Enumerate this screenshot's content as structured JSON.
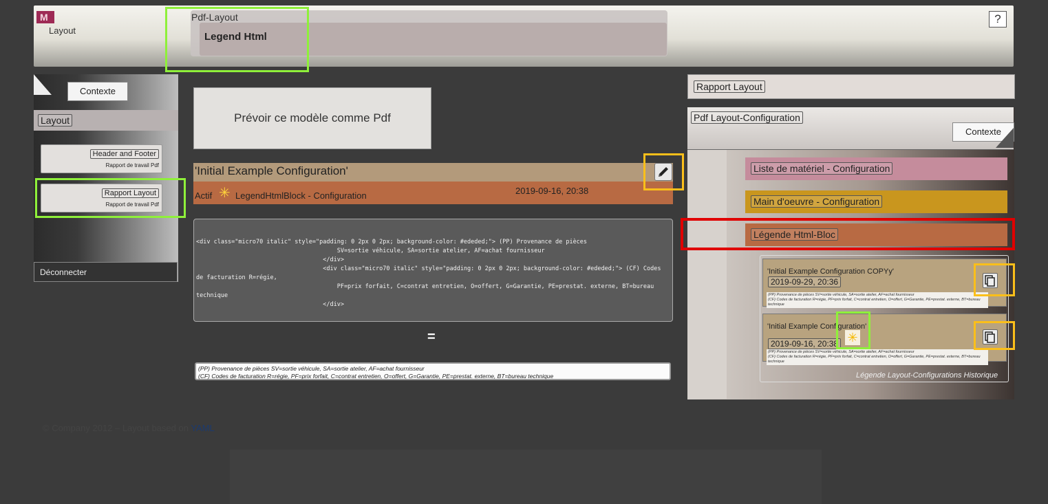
{
  "header": {
    "app_name": "Layout",
    "breadcrumb": "Pdf-Layout",
    "active_tab": "Legend Html",
    "help_label": "?"
  },
  "left": {
    "contexte_label": "Contexte",
    "section_title": "Layout",
    "items": [
      {
        "label": "Header and Footer",
        "sub": "Rapport de travail Pdf"
      },
      {
        "label": "Rapport Layout",
        "sub": "Rapport de travail Pdf"
      }
    ],
    "disconnect_label": "Déconnecter"
  },
  "center": {
    "pdf_button": "Prévoir ce modèle comme Pdf",
    "config_title": "'Initial Example Configuration'",
    "status": {
      "active": "Actif",
      "block": "LegendHtmlBlock  -  Configuration",
      "date": "2019-09-16, 20:38"
    },
    "code": "<div class=\"micro70 italic\" style=\"padding: 0 2px 0 2px; background-color: #ededed;\"> (PP) Provenance de pièces\n                                        SV=sortie véhicule, SA=sortie atelier, AF=achat fournisseur\n                                    </div>\n                                    <div class=\"micro70 italic\" style=\"padding: 0 2px 0 2px; background-color: #ededed;\"> (CF) Codes de facturation R=régie,\n                                        PF=prix forfait, C=contrat entretien, O=offert, G=Garantie, PE=prestat. externe, BT=bureau technique\n                                    </div>",
    "equals": "=",
    "preview_line1": "(PP) Provenance de pièces SV=sortie véhicule, SA=sortie atelier, AF=achat fournisseur",
    "preview_line2": "(CF) Codes de facturation R=régie, PF=prix forfait, C=contrat entretien, O=offert, G=Garantie, PE=prestat. externe, BT=bureau technique"
  },
  "right": {
    "rapport_title": "Rapport Layout",
    "pdf_config_title": "Pdf Layout-Configuration",
    "contexte_label": "Contexte",
    "config_items": [
      {
        "label": "Liste de matériel - Configuration",
        "color": "#c58c9c"
      },
      {
        "label": "Main d'oeuvre - Configuration",
        "color": "#c9961e"
      },
      {
        "label": "Légende Html-Bloc",
        "color": "#b86a43"
      }
    ],
    "history": [
      {
        "title": "'Initial Example Configuration COPYy'",
        "date": "2019-09-29, 20:36",
        "mini1": "(PP) Provenance de pièces SV=sortie véhicule, SA=sortie atelier, AF=achat fournisseur",
        "mini2": "(CF) Codes de facturation R=régie, PF=prix forfait, C=contrat entretien, O=offert, G=Garantie, PE=prestat. externe, BT=bureau technique"
      },
      {
        "title": "'Initial Example Configuration'",
        "date": "2019-09-16, 20:38",
        "mini1": "(PP) Provenance de pièces SV=sortie véhicule, SA=sortie atelier, AF=achat fournisseur",
        "mini2": "(CF) Codes de facturation R=régie, PF=prix forfait, C=contrat entretien, O=offert, G=Garantie, PE=prestat. externe, BT=bureau technique"
      }
    ],
    "history_label": "Légende Layout-Configurations Historique"
  },
  "footer": {
    "text": "© Company 2012 – Layout based on ",
    "link": "YAML"
  },
  "icons": {
    "edit": "pencil-icon",
    "copy": "copy-icon",
    "active": "star-icon"
  }
}
